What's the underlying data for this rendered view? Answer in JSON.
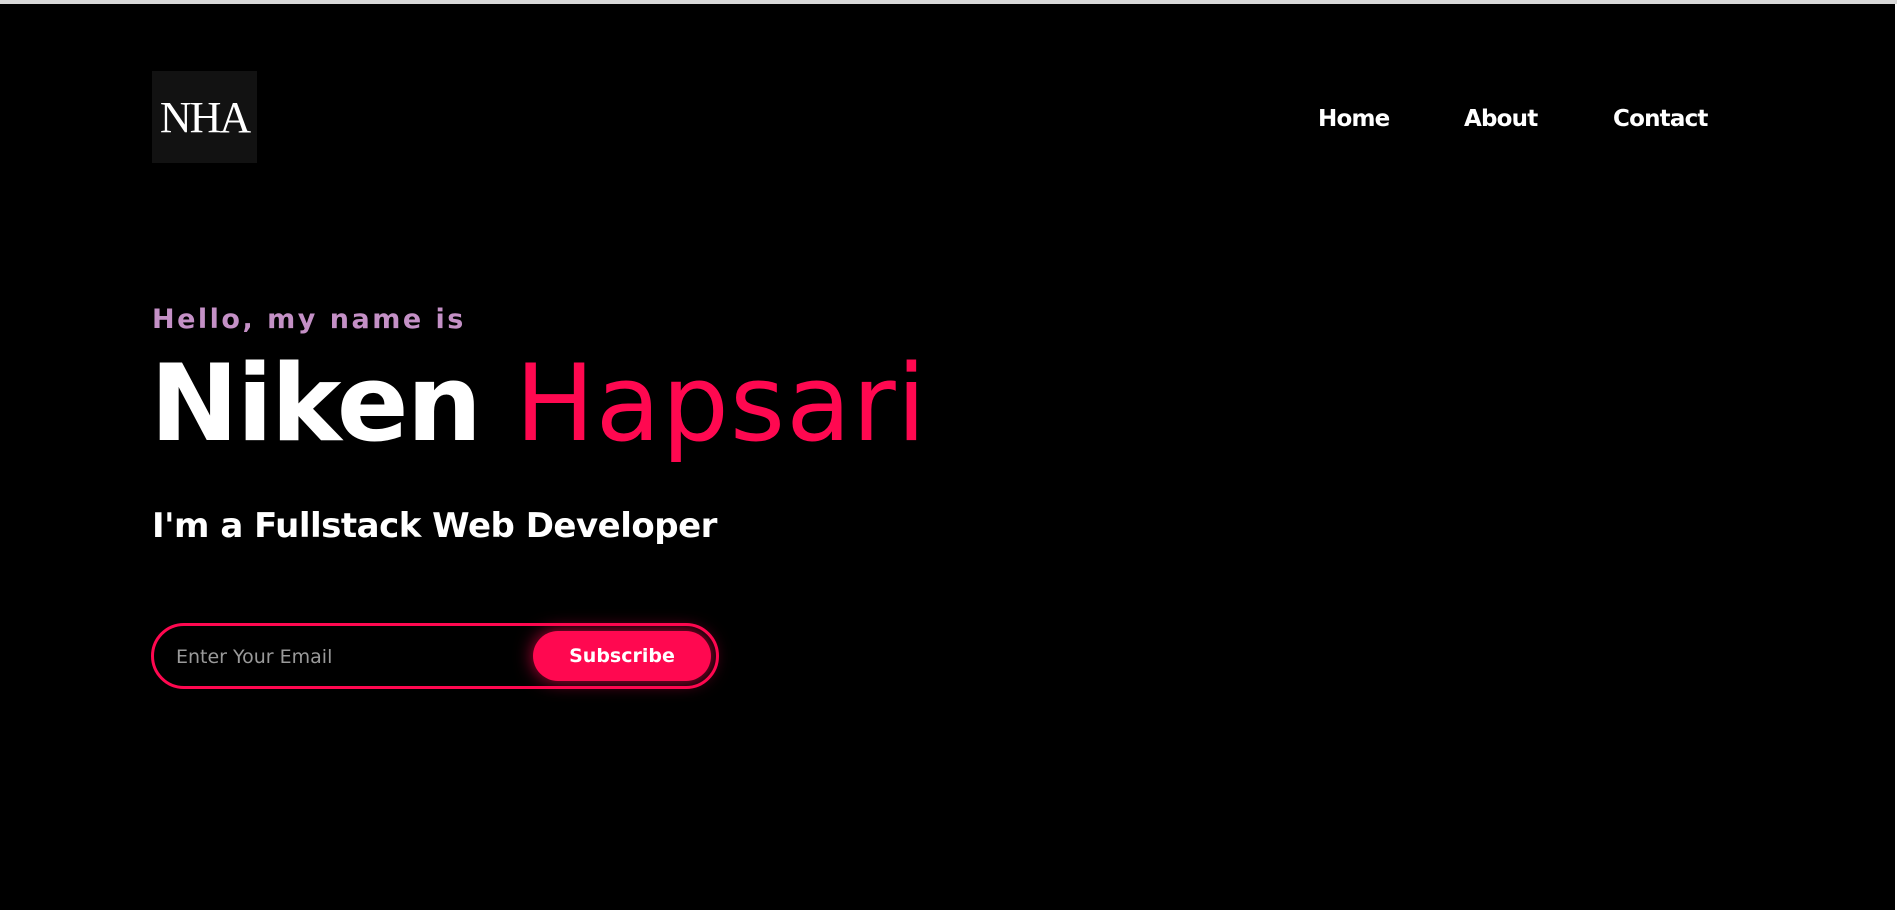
{
  "header": {
    "logo_text": "NHA",
    "nav": [
      {
        "label": "Home"
      },
      {
        "label": "About"
      },
      {
        "label": "Contact"
      }
    ]
  },
  "hero": {
    "greeting": "Hello, my name is",
    "first_name": "Niken",
    "last_name": "Hapsari",
    "role": "I'm a Fullstack Web Developer"
  },
  "subscribe": {
    "email_placeholder": "Enter Your Email",
    "email_value": "",
    "button_label": "Subscribe"
  },
  "colors": {
    "background": "#000000",
    "accent": "#ff0850",
    "greeting": "#c490c6",
    "text": "#ffffff"
  }
}
